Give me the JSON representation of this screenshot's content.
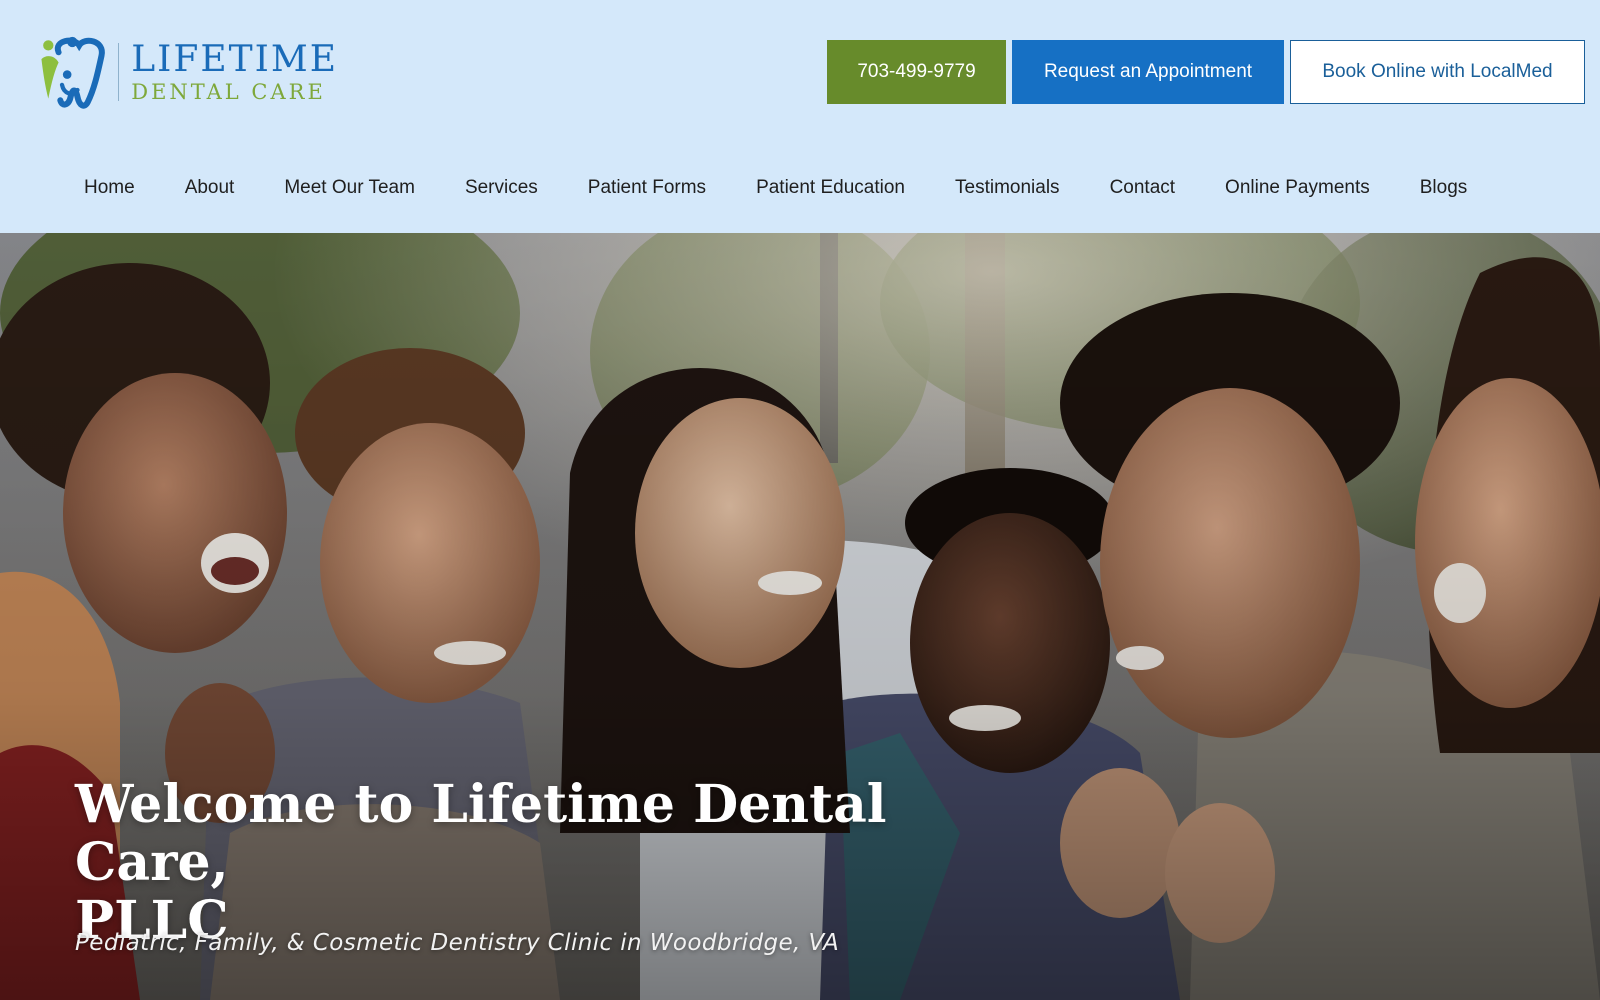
{
  "brand": {
    "name_line1": "LIFETIME",
    "name_line2": "DENTAL CARE",
    "primary_color": "#1670c4",
    "accent_color": "#678b2b",
    "header_bg": "#d4e8fa",
    "logo_icon": "tooth-family-logo-icon"
  },
  "header": {
    "phone_label": "703-499-9779",
    "appointment_label": "Request an Appointment",
    "book_online_label": "Book Online with LocalMed"
  },
  "nav": {
    "items": [
      {
        "label": "Home"
      },
      {
        "label": "About"
      },
      {
        "label": "Meet Our Team"
      },
      {
        "label": "Services"
      },
      {
        "label": "Patient Forms"
      },
      {
        "label": "Patient Education"
      },
      {
        "label": "Testimonials"
      },
      {
        "label": "Contact"
      },
      {
        "label": "Online Payments"
      },
      {
        "label": "Blogs"
      }
    ]
  },
  "hero": {
    "title_line1": "Welcome to Lifetime Dental Care,",
    "title_line2": "PLLC",
    "subtitle": "Pediatric, Family, & Cosmetic Dentistry Clinic in Woodbridge, VA",
    "image_icon": "group-of-smiling-friends-photo"
  }
}
